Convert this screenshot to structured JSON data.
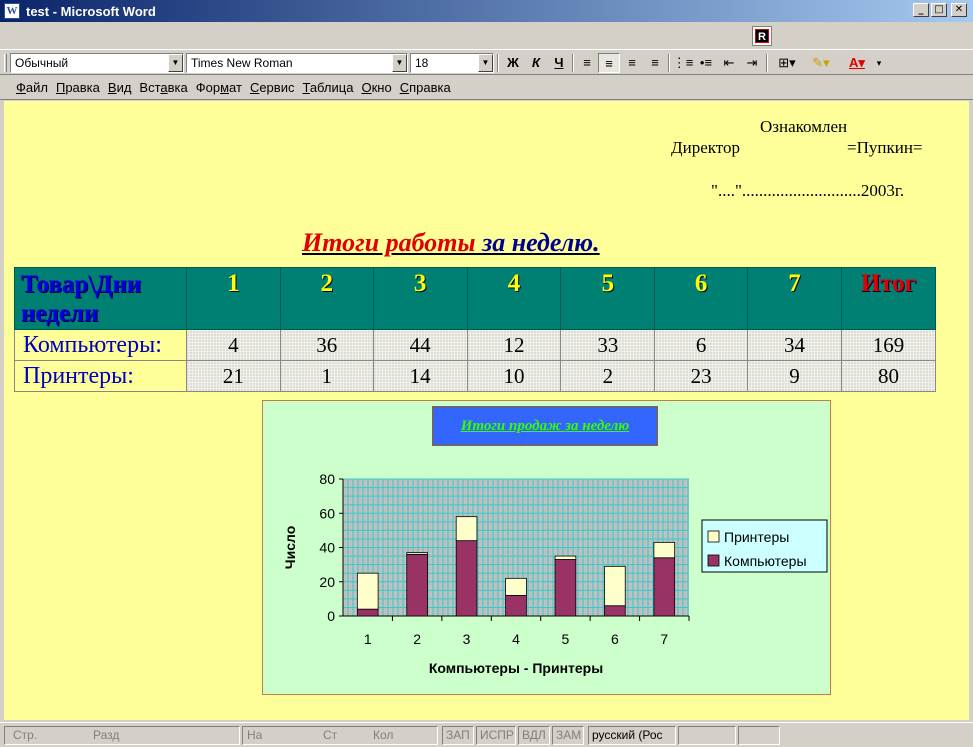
{
  "window": {
    "title": "test - Microsoft Word",
    "minimize": "_",
    "maximize": "□",
    "close": "✕"
  },
  "toolbar": {
    "style_value": "Обычный",
    "font_value": "Times New Roman",
    "size_value": "18",
    "bold": "Ж",
    "italic": "К",
    "underline": "Ч",
    "align_left": "≡",
    "align_center": "≡",
    "align_right": "≡",
    "justify": "≡"
  },
  "menu": {
    "items": [
      {
        "pre": "",
        "u": "Ф",
        "post": "айл"
      },
      {
        "pre": "",
        "u": "П",
        "post": "равка"
      },
      {
        "pre": "",
        "u": "В",
        "post": "ид"
      },
      {
        "pre": "Вст",
        "u": "а",
        "post": "вка"
      },
      {
        "pre": "Фор",
        "u": "м",
        "post": "ат"
      },
      {
        "pre": "",
        "u": "С",
        "post": "ервис"
      },
      {
        "pre": "",
        "u": "Т",
        "post": "аблица"
      },
      {
        "pre": "",
        "u": "О",
        "post": "кно"
      },
      {
        "pre": "",
        "u": "С",
        "post": "правка"
      }
    ]
  },
  "approval": {
    "line1": "Ознакомлен",
    "line2_left": "Директор",
    "line2_right": "=Пупкин=",
    "line3": "\"....\"............................2003г."
  },
  "doc_title": {
    "part1": "Итоги работы",
    "part2": "за неделю."
  },
  "table": {
    "headers": [
      "Товар\\Дни недели",
      "1",
      "2",
      "3",
      "4",
      "5",
      "6",
      "7",
      "Итог"
    ],
    "rows": [
      {
        "label": "Компьютеры:",
        "values": [
          "4",
          "36",
          "44",
          "12",
          "33",
          "6",
          "34",
          "169"
        ]
      },
      {
        "label": "Принтеры:",
        "values": [
          "21",
          "1",
          "14",
          "10",
          "2",
          "23",
          "9",
          "80"
        ]
      }
    ]
  },
  "chart_title": "Итоги продаж за неделю",
  "chart_data": {
    "type": "bar",
    "stacked": true,
    "categories": [
      "1",
      "2",
      "3",
      "4",
      "5",
      "6",
      "7"
    ],
    "series": [
      {
        "name": "Компьютеры",
        "color": "#993366",
        "values": [
          4,
          36,
          44,
          12,
          33,
          6,
          34
        ]
      },
      {
        "name": "Принтеры",
        "color": "#ffffcc",
        "values": [
          21,
          1,
          14,
          10,
          2,
          23,
          9
        ]
      }
    ],
    "legend_order": [
      "Принтеры",
      "Компьютеры"
    ],
    "xlabel": "Компьютеры - Принтеры",
    "ylabel": "Число",
    "ylim": [
      0,
      80
    ],
    "yticks": [
      0,
      20,
      40,
      60,
      80
    ],
    "grid": true,
    "plot_bg": "#c0c0c0",
    "grid_color": "#33cccc",
    "legend_position": "right"
  },
  "status": {
    "page": "Стр.",
    "section": "Разд",
    "at": "На",
    "line": "Ст",
    "col": "Кол",
    "rec": "ЗАП",
    "trk": "ИСПР",
    "ext": "ВДЛ",
    "ovr": "ЗАМ",
    "lang": "русский (Рос"
  }
}
